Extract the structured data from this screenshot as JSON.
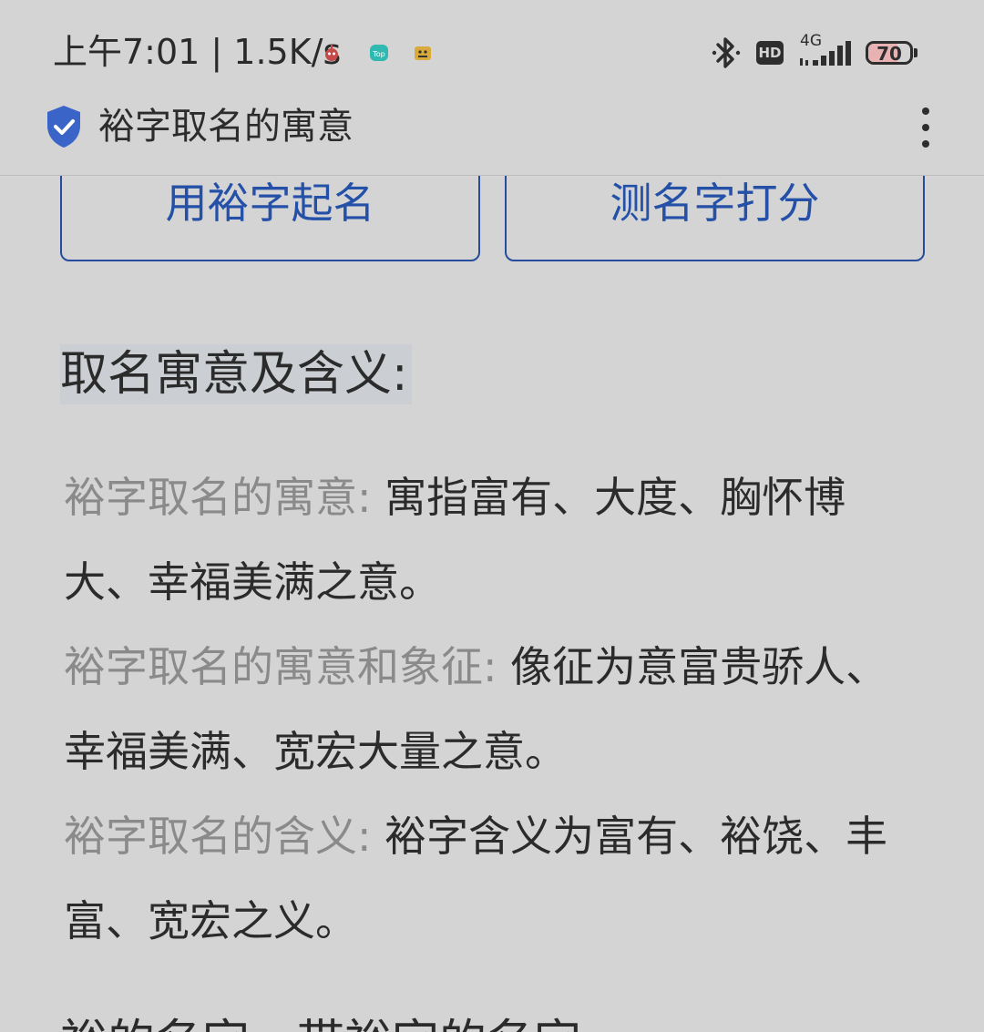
{
  "status_bar": {
    "time_speed": "上午7:01 | 1.5K/s",
    "notification_icons": [
      "robot-app-icon",
      "top-app-icon",
      "cat-app-icon"
    ],
    "network_type": "4G",
    "hd_label": "HD",
    "battery_level": 70,
    "battery_label": "70"
  },
  "title_bar": {
    "title": "裕字取名的寓意",
    "security_icon": "shield-check-icon",
    "menu_icon": "more-vertical-icon"
  },
  "actions": {
    "name_with_char_label": "用裕字起名",
    "score_name_label": "测名字打分"
  },
  "content": {
    "section_heading": "取名寓意及含义:",
    "meanings": [
      {
        "label": "裕字取名的寓意:",
        "value": "寓指富有、大度、胸怀博大、幸福美满之意。"
      },
      {
        "label": "裕字取名的寓意和象征:",
        "value": "像征为意富贵骄人、幸福美满、宽宏大量之意。"
      },
      {
        "label": "裕字取名的含义:",
        "value": "裕字含义为富有、裕饶、丰富、宽宏之义。"
      }
    ],
    "next_heading": "裕的名字，带裕字的名字"
  },
  "colors": {
    "background": "#d4d4d4",
    "accent_blue": "#2450a8",
    "label_gray": "#8a8a8a",
    "text_dark": "#2b2b2b",
    "shield_blue": "#3b64c9"
  }
}
